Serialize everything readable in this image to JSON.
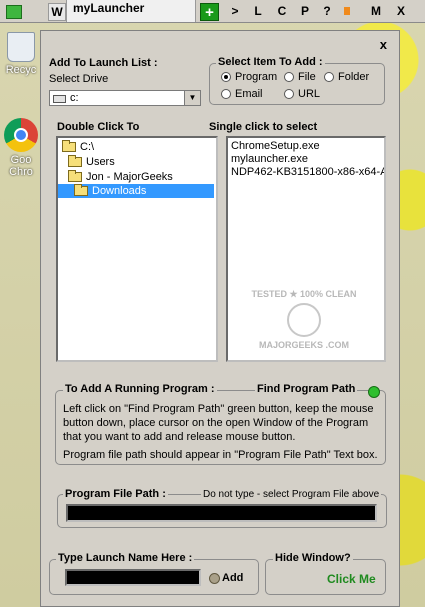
{
  "desktop": {
    "recycle_label": "Recyc",
    "chrome_label_1": "Goo",
    "chrome_label_2": "Chro"
  },
  "titlebar": {
    "w_label": "W",
    "title": "myLauncher",
    "plus_label": "+",
    "buttons": [
      ">",
      "L",
      "C",
      "P",
      "?",
      "M",
      "X"
    ]
  },
  "window": {
    "close_label": "x",
    "add_to_launch_list": "Add To Launch List :",
    "select_drive_label": "Select Drive",
    "drive_value": "c:",
    "select_item_title": "Select Item To Add :",
    "radios": {
      "program": "Program",
      "file": "File",
      "folder": "Folder",
      "email": "Email",
      "url": "URL"
    },
    "selected_radio": "program",
    "double_click_title": "Double Click To",
    "single_click_title": "Single click to select",
    "tree": [
      "C:\\",
      "Users",
      "Jon - MajorGeeks",
      "Downloads"
    ],
    "selected_tree_item": "Downloads",
    "files": [
      "ChromeSetup.exe",
      "mylauncher.exe",
      "NDP462-KB3151800-x86-x64-Al"
    ],
    "running_title": "To Add A Running Program :",
    "find_path_label": "Find Program Path",
    "instructions_1": "Left click on \"Find Program Path\" green button, keep the mouse button down, place cursor on the open Window of the Program that you want to add and release mouse button.",
    "instructions_2": "Program file path should appear in \"Program File Path\" Text box.",
    "file_path_title": "Program File Path :",
    "file_path_hint": "Do not type - select Program File above",
    "file_path_value": "",
    "launch_name_title": "Type Launch Name Here :",
    "launch_name_value": "",
    "add_label": "Add",
    "hide_window_title": "Hide Window?",
    "click_me_label": "Click Me"
  },
  "colors": {
    "selection": "#3399ff",
    "click_me": "#1f8a1f",
    "plus_button": "#1a9a1a"
  }
}
